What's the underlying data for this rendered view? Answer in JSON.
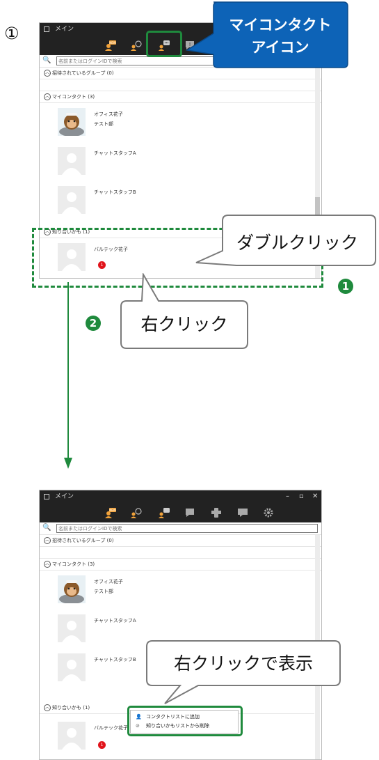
{
  "step1_label": "①",
  "window": {
    "title": "メイン",
    "search_placeholder": "名前またはログインIDで検索",
    "groups": {
      "invited": "招待されているグループ (0)",
      "my_contacts": "マイコンタクト (3)",
      "maybe_known": "知り合いかも (1)"
    },
    "contacts": [
      {
        "name": "オフィス花子",
        "dept": "テスト部"
      },
      {
        "name": "チャットスタッフA",
        "dept": ""
      },
      {
        "name": "チャットスタッフB",
        "dept": ""
      }
    ],
    "maybe_contact": {
      "name": "バルテック花子",
      "badge": "1"
    },
    "toolbar_icons": [
      "new-contact-icon",
      "contact-search-icon",
      "my-contact-icon",
      "chat-icon",
      "phone-icon",
      "message-icon",
      "settings-icon"
    ],
    "window_controls": {
      "minimize": "–",
      "maximize": "▫",
      "close": "✕"
    }
  },
  "callouts": {
    "my_contact_icon": [
      "マイコンタクト",
      "アイコン"
    ],
    "double_click": "ダブルクリック",
    "right_click": "右クリック",
    "right_click_show": "右クリックで表示"
  },
  "steps": {
    "one": "1",
    "two": "2"
  },
  "context_menu": {
    "items": [
      {
        "label": "コンタクトリストに追加",
        "icon": "add-contact-icon"
      },
      {
        "label": "知り合いかもリストから削除",
        "icon": "prohibit-icon"
      }
    ]
  },
  "colors": {
    "accent_green": "#1f8a3d",
    "callout_blue": "#0d63b7",
    "badge_red": "#e1141b",
    "dark_bar": "#222222"
  }
}
